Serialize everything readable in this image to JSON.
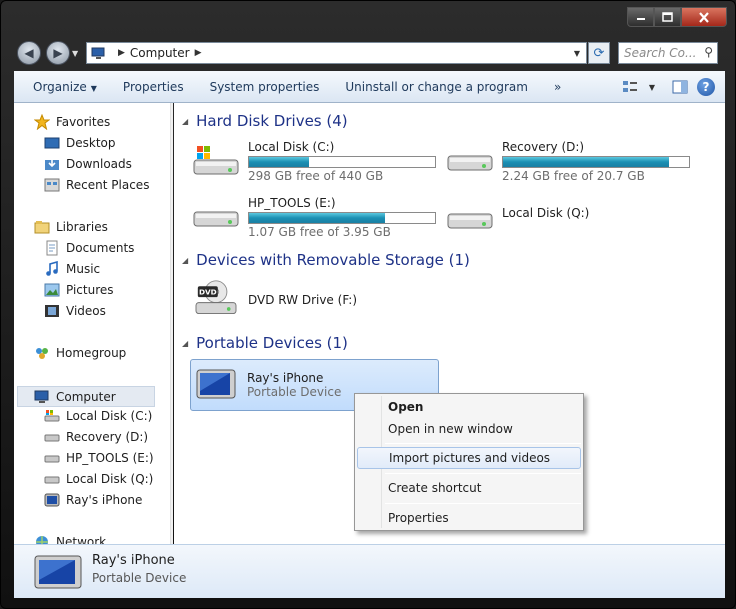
{
  "window": {
    "caption_buttons": [
      "minimize",
      "maximize",
      "close"
    ]
  },
  "address": {
    "location": "Computer",
    "search_placeholder": "Search Co..."
  },
  "toolbar": {
    "organize": "Organize",
    "properties": "Properties",
    "system_properties": "System properties",
    "uninstall": "Uninstall or change a program",
    "more": "»"
  },
  "nav": {
    "favorites": "Favorites",
    "desktop": "Desktop",
    "downloads": "Downloads",
    "recent_places": "Recent Places",
    "libraries": "Libraries",
    "documents": "Documents",
    "music": "Music",
    "pictures": "Pictures",
    "videos": "Videos",
    "homegroup": "Homegroup",
    "computer": "Computer",
    "local_disk_c": "Local Disk (C:)",
    "recovery_d": "Recovery (D:)",
    "hp_tools_e": "HP_TOOLS (E:)",
    "local_disk_q": "Local Disk (Q:)",
    "rays_iphone": "Ray's iPhone",
    "network": "Network"
  },
  "groups": {
    "hard_disks": "Hard Disk Drives (4)",
    "removable": "Devices with Removable Storage (1)",
    "portable": "Portable Devices (1)"
  },
  "drives": {
    "c": {
      "name": "Local Disk (C:)",
      "free": "298 GB free of 440 GB",
      "used_fraction": 0.32
    },
    "d": {
      "name": "Recovery (D:)",
      "free": "2.24 GB free of 20.7 GB",
      "used_fraction": 0.89
    },
    "e": {
      "name": "HP_TOOLS (E:)",
      "free": "1.07 GB free of 3.95 GB",
      "used_fraction": 0.73
    },
    "q": {
      "name": "Local Disk (Q:)"
    },
    "f": {
      "name": "DVD RW Drive (F:)",
      "badge": "DVD"
    }
  },
  "device": {
    "name": "Ray's iPhone",
    "type": "Portable Device"
  },
  "context_menu": {
    "open": "Open",
    "open_new_window": "Open in new window",
    "import": "Import pictures and videos",
    "create_shortcut": "Create shortcut",
    "properties": "Properties"
  },
  "details": {
    "name": "Ray's iPhone",
    "type": "Portable Device"
  },
  "colors": {
    "group_header": "#1e3287",
    "bar_fill": "#1b8fb3",
    "selection": "#c1dcfc"
  }
}
